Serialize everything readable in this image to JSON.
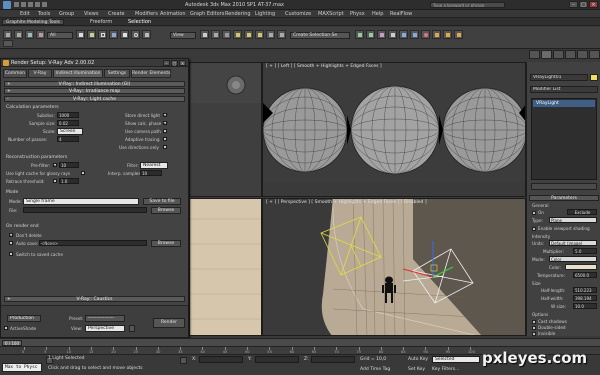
{
  "window": {
    "title": "Autodesk 3ds Max 2010 SP1     AT-37.max",
    "search_placeholder": "Type a keyword or phrase"
  },
  "menu": [
    "Edit",
    "Tools",
    "Group",
    "Views",
    "Create",
    "Modifiers",
    "Animation",
    "Graph Editors",
    "Rendering",
    "Lighting",
    "Customize",
    "MAXScript",
    "Physx",
    "Help",
    "RealFlow"
  ],
  "ribbon": {
    "tag": "Graphite Modeling Tools",
    "tabs": [
      "Freeform",
      "Selection"
    ],
    "active_tab": "Selection"
  },
  "toolbar": {
    "selection_filter": "All",
    "reference_coord": "View",
    "named_selection": "Create Selection Se"
  },
  "viewports": {
    "left_label": "[ + ] [ Left ] [ Smooth + Highlights + Edged Faces ]",
    "persp_label": "[ + ] [ Perspective ] [ Smooth + Highlights + Edged Faces ] [ Disabled ]"
  },
  "dialog": {
    "title": "Render Setup: V-Ray Adv 2.00.02",
    "tabs": [
      "Common",
      "V-Ray",
      "Indirect illumination",
      "Settings",
      "Render Elements"
    ],
    "active_tab": "Indirect illumination",
    "rollouts": {
      "gi": "V-Ray:: Indirect illumination (GI)",
      "irradiance": "V-Ray:: Irradiance map",
      "light_cache": "V-Ray:: Light cache",
      "caustics": "V-Ray:: Caustics"
    },
    "calc": {
      "heading": "Calculation parameters",
      "subdivs_label": "Subdivs:",
      "subdivs": "1000",
      "sample_size_label": "Sample size:",
      "sample_size": "0.02",
      "scale_label": "Scale:",
      "scale": "Screen",
      "passes_label": "Number of passes:",
      "passes": "4",
      "store_direct": "Store direct light",
      "show_calc": "Show calc. phase",
      "use_camera": "Use camera path",
      "adaptive": "Adaptive tracing",
      "directions_only": "Use directions only"
    },
    "recon": {
      "heading": "Reconstruction parameters",
      "prefilter_label": "Pre-filter:",
      "prefilter": "10",
      "glossy_rays": "Use light cache for glossy rays",
      "interp_label": "Retrace threshold:",
      "interp": "1.0",
      "filter_label": "Filter:",
      "filter": "Nearest",
      "interp_samples_label": "Interp. samples:",
      "interp_samples": "10"
    },
    "mode": {
      "heading": "Mode",
      "label": "Mode:",
      "value": "Single frame",
      "save_btn": "Save to file",
      "file_label": "File:",
      "browse_btn": "Browse"
    },
    "after": {
      "heading": "On render end",
      "dont_delete": "Don't delete",
      "auto_save": "Auto save:",
      "auto_save_value": "<None>",
      "browse_btn": "Browse",
      "switch": "Switch to saved cache"
    },
    "bottom": {
      "mode_value": "Production",
      "activeshade": "ActiveShade",
      "preset_label": "Preset:",
      "preset_value": "----------------",
      "view_label": "View:",
      "view_value": "Perspective",
      "render_btn": "Render"
    }
  },
  "command_panel": {
    "object_name": "VRayLight01",
    "modifier_list": "Modifier List",
    "stack_item": "VRayLight",
    "rollout_params": "Parameters",
    "general": "General",
    "on_label": "On",
    "exclude_btn": "Exclude",
    "type_label": "Type:",
    "type_value": "Plane",
    "enable_vp": "Enable viewport shading",
    "intensity": "Intensity",
    "units_label": "Units:",
    "units_value": "Default (image)",
    "multiplier_label": "Multiplier:",
    "multiplier": "5.0",
    "mode_label": "Mode:",
    "mode_value": "Color",
    "color_label": "Color:",
    "temperature_label": "Temperature:",
    "temperature": "6500.0",
    "size_heading": "Size",
    "half_length_label": "Half-length:",
    "half_length": "510.223",
    "half_width_label": "Half-width:",
    "half_width": "398.194",
    "wsize_label": "W size:",
    "wsize": "10.0",
    "options_heading": "Options",
    "cast_shadows": "Cast shadows",
    "double_sided": "Double-sided",
    "invisible": "Invisible",
    "ignore_normals": "Ignore light normals",
    "no_decay": "No decay"
  },
  "timeline": {
    "slider": "0 / 100",
    "ticks": [
      "0",
      "5",
      "10",
      "15",
      "20",
      "25",
      "30",
      "35",
      "40",
      "45",
      "50",
      "55",
      "60",
      "65",
      "70",
      "75",
      "80",
      "85",
      "90",
      "95",
      "100"
    ]
  },
  "status": {
    "maxscript": "Max to Physc",
    "selected": "1 Light Selected",
    "prompt": "Click and drag to select and move objects",
    "x_label": "X:",
    "y_label": "Y:",
    "z_label": "Z:",
    "grid": "Grid = 10,0",
    "autokey": "Auto Key",
    "selected_field": "Selected",
    "setkey": "Set Key",
    "keyfilters": "Key Filters...",
    "add_time_tag": "Add Time Tag"
  },
  "watermark": "pxleyes.com",
  "colors": {
    "ui_dark": "#3a3a3a",
    "selection_blue": "#3f5f86",
    "light_yellow": "#e2dd3a",
    "light_white": "#f0f0f0",
    "gizmo_red": "#e03030",
    "gizmo_green": "#3ad23a",
    "gizmo_blue": "#3a6be0",
    "floor_tan": "#d4c3a8"
  }
}
